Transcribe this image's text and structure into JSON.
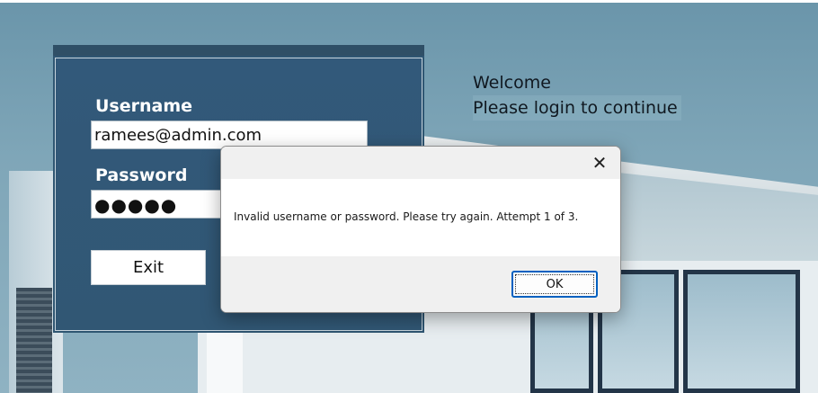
{
  "login": {
    "username_label": "Username",
    "username_value": "ramees@admin.com",
    "password_label": "Password",
    "password_value": "●●●●●",
    "exit_label": "Exit"
  },
  "welcome": {
    "line1": "Welcome",
    "line2": "Please login to continue"
  },
  "dialog": {
    "close_glyph": "✕",
    "message": "Invalid username or password. Please try again. Attempt 1 of 3.",
    "ok_label": "OK"
  },
  "colors": {
    "panel": "#2f5672",
    "dialog_footer": "#f0f0f0",
    "ok_border": "#0060c0"
  }
}
